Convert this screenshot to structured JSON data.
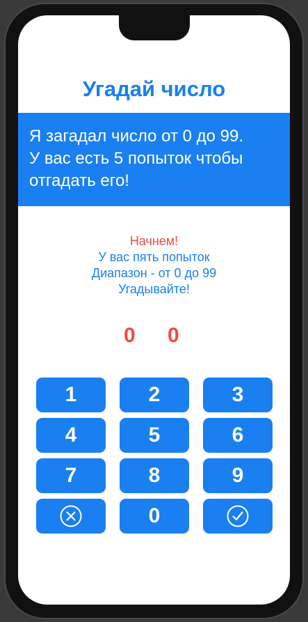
{
  "app": {
    "title": "Угадай число"
  },
  "banner": {
    "lines": [
      "Я загадал число от 0 до 99.",
      "У вас есть 5 попыток чтобы",
      "отгадать его!"
    ]
  },
  "status": {
    "headline": "Начнем!",
    "lines": [
      "У вас пять попыток",
      "Диапазон - от 0 до 99",
      "Угадывайте!"
    ]
  },
  "input": {
    "digits": [
      "0",
      "0"
    ]
  },
  "keypad": {
    "keys": [
      {
        "label": "1"
      },
      {
        "label": "2"
      },
      {
        "label": "3"
      },
      {
        "label": "4"
      },
      {
        "label": "5"
      },
      {
        "label": "6"
      },
      {
        "label": "7"
      },
      {
        "label": "8"
      },
      {
        "label": "9"
      },
      {
        "icon": "clear-circle-x-icon"
      },
      {
        "label": "0"
      },
      {
        "icon": "confirm-check-circle-icon"
      }
    ]
  },
  "colors": {
    "accent": "#1a7ff0",
    "error": "#f04a43",
    "background": "#ffffff"
  }
}
